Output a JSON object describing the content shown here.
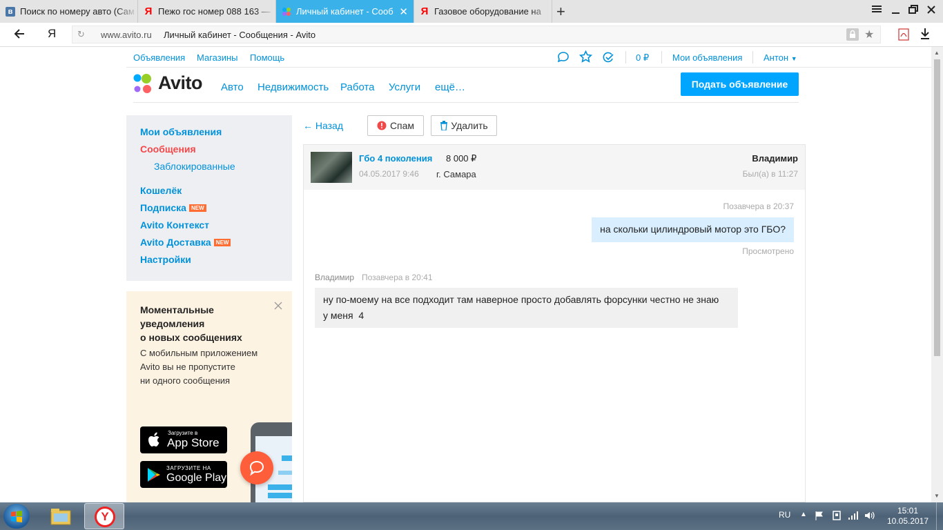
{
  "browser": {
    "tabs": [
      {
        "label": "Поиск по номеру авто (Сам",
        "favicon": "vk-icon",
        "active": false
      },
      {
        "label": "Пежо гос номер 088 163 —",
        "favicon": "yandex-icon",
        "active": false
      },
      {
        "label": "Личный кабинет - Сооб",
        "favicon": "avito-icon",
        "active": true
      },
      {
        "label": "Газовое оборудование на",
        "favicon": "yandex-icon",
        "active": false
      }
    ],
    "address": {
      "domain": "www.avito.ru",
      "title": "Личный кабинет - Сообщения - Avito"
    }
  },
  "site": {
    "top_links": {
      "ads": "Объявления",
      "shops": "Магазины",
      "help": "Помощь"
    },
    "balance": "0 ₽",
    "my_ads": "Мои объявления",
    "user": "Антон",
    "logo": "Avito",
    "nav": [
      "Авто",
      "Недвижимость",
      "Работа",
      "Услуги",
      "ещё…"
    ],
    "post_button": "Подать объявление"
  },
  "sidebar": {
    "items": [
      {
        "label": "Мои объявления",
        "badge": ""
      },
      {
        "label": "Сообщения",
        "badge": ""
      },
      {
        "label": "Заблокированные",
        "badge": ""
      },
      {
        "label": "Кошелёк",
        "badge": ""
      },
      {
        "label": "Подписка",
        "badge": "NEW"
      },
      {
        "label": "Avito Контекст",
        "badge": ""
      },
      {
        "label": "Avito Доставка",
        "badge": "NEW"
      },
      {
        "label": "Настройки",
        "badge": ""
      }
    ]
  },
  "promo": {
    "title_line1": "Моментальные",
    "title_line2": "уведомления",
    "title_line3": "о новых сообщениях",
    "text_line1": "С мобильным приложением",
    "text_line2": "Avito вы не пропустите",
    "text_line3": "ни одного сообщения",
    "appstore_small": "Загрузите в",
    "appstore_big": "App Store",
    "gplay_small": "ЗАГРУЗИТЕ НА",
    "gplay_big": "Google Play"
  },
  "actions": {
    "back": "← Назад",
    "spam": "Спам",
    "delete": "Удалить"
  },
  "chat": {
    "item_title": "Гбо 4 поколения",
    "item_price": "8 000 ₽",
    "item_date": "04.05.2017 9:46",
    "item_city": "г. Самара",
    "contact_name": "Владимир",
    "contact_status": "Был(а) в 11:27",
    "messages": [
      {
        "author": "",
        "time": "Позавчера в 20:37",
        "text": "на скольки цилиндровый мотор это ГБО?",
        "status": "Просмотрено",
        "outgoing": true
      },
      {
        "author": "Владимир",
        "time": "Позавчера в 20:41",
        "text_line1": "ну по-моему на все подходит там наверное просто добавлять форсунки честно не знаю",
        "text_line2": "у меня  4",
        "outgoing": false
      }
    ]
  },
  "taskbar": {
    "lang": "RU",
    "time": "15:01",
    "date": "10.05.2017"
  },
  "colors": {
    "link": "#0091d9",
    "active_menu": "#f1484a",
    "button": "#00a5ff",
    "new_badge": "#ff6d33",
    "outgoing_bubble": "#d9efff",
    "incoming_bubble": "#f0f0f0",
    "tab_active": "#3bb1ea"
  }
}
